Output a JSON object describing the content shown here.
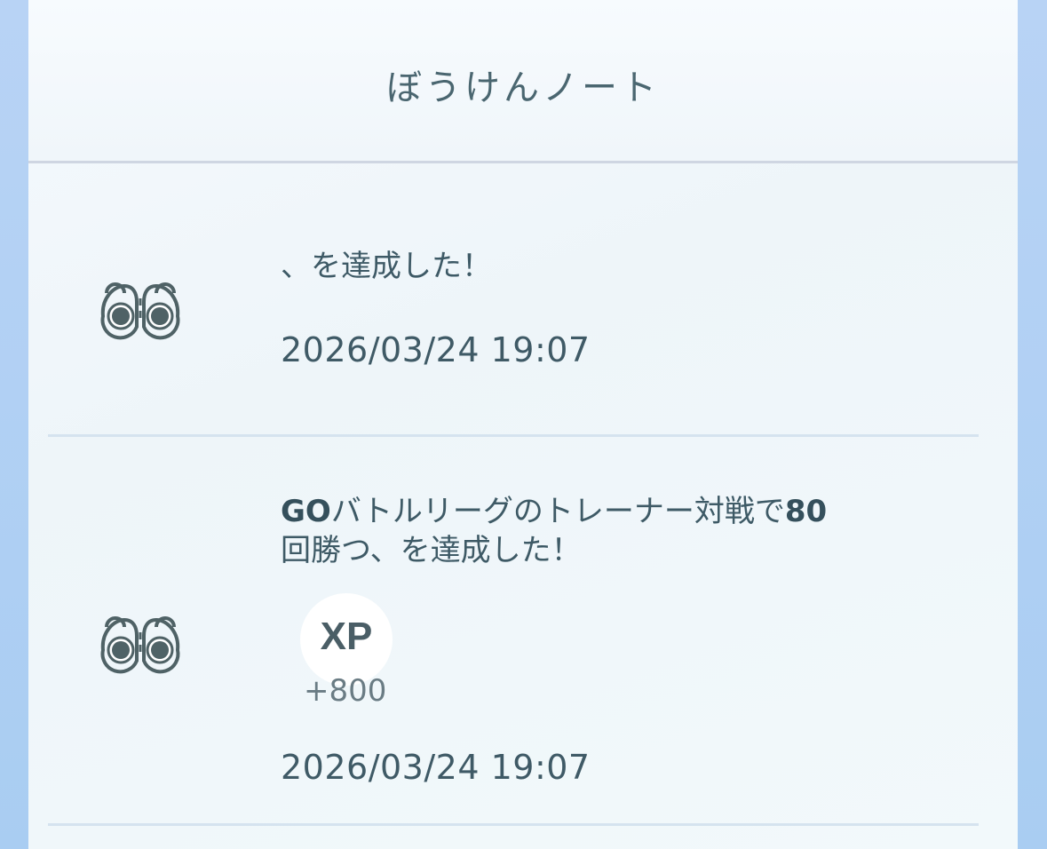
{
  "screen": {
    "title": "ぼうけんノート"
  },
  "entries": [
    {
      "icon": "binoculars-icon",
      "text": "、を達成した！",
      "date": "2026/03/24 19:07"
    },
    {
      "icon": "binoculars-icon",
      "text_parts": [
        {
          "text": "GO",
          "bold": true
        },
        {
          "text": "バトルリーグのトレーナー対戦で",
          "bold": false
        },
        {
          "text": "80",
          "bold": true
        },
        {
          "text": "回勝つ、を達成した！",
          "bold": false
        }
      ],
      "reward": {
        "label": "XP",
        "amount": "+800"
      },
      "date": "2026/03/24 19:07"
    }
  ],
  "colors": {
    "background": "#b8d3f5",
    "panel": "#f2f7fb",
    "text": "#3e5a66",
    "divider": "#d5e3ef"
  }
}
